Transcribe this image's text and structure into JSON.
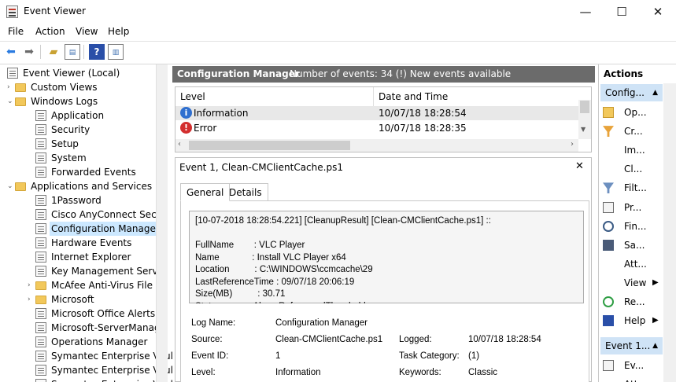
{
  "window": {
    "title": "Event Viewer",
    "minimize": "—",
    "maximize": "☐",
    "close": "✕"
  },
  "menu": [
    "File",
    "Action",
    "View",
    "Help"
  ],
  "tree": {
    "items": [
      {
        "label": "Event Viewer (Local)",
        "depth": 0,
        "icon": "log",
        "twist": ""
      },
      {
        "label": "Custom Views",
        "depth": 1,
        "icon": "folder",
        "twist": "›"
      },
      {
        "label": "Windows Logs",
        "depth": 1,
        "icon": "folder",
        "twist": "⌄"
      },
      {
        "label": "Application",
        "depth": 2,
        "icon": "log",
        "twist": ""
      },
      {
        "label": "Security",
        "depth": 2,
        "icon": "log",
        "twist": ""
      },
      {
        "label": "Setup",
        "depth": 2,
        "icon": "log",
        "twist": ""
      },
      {
        "label": "System",
        "depth": 2,
        "icon": "log",
        "twist": ""
      },
      {
        "label": "Forwarded Events",
        "depth": 2,
        "icon": "log",
        "twist": ""
      },
      {
        "label": "Applications and Services Lo",
        "depth": 1,
        "icon": "folder",
        "twist": "⌄"
      },
      {
        "label": "1Password",
        "depth": 2,
        "icon": "log",
        "twist": ""
      },
      {
        "label": "Cisco AnyConnect Secur",
        "depth": 2,
        "icon": "log",
        "twist": ""
      },
      {
        "label": "Configuration Manager",
        "depth": 2,
        "icon": "log",
        "twist": "",
        "selected": true
      },
      {
        "label": "Hardware Events",
        "depth": 2,
        "icon": "log",
        "twist": ""
      },
      {
        "label": "Internet Explorer",
        "depth": 2,
        "icon": "log",
        "twist": ""
      },
      {
        "label": "Key Management Servic",
        "depth": 2,
        "icon": "log",
        "twist": ""
      },
      {
        "label": "McAfee Anti-Virus File Sy",
        "depth": 2,
        "icon": "folder",
        "twist": "›"
      },
      {
        "label": "Microsoft",
        "depth": 2,
        "icon": "folder",
        "twist": "›"
      },
      {
        "label": "Microsoft Office Alerts",
        "depth": 2,
        "icon": "log",
        "twist": ""
      },
      {
        "label": "Microsoft-ServerManage",
        "depth": 2,
        "icon": "log",
        "twist": ""
      },
      {
        "label": "Operations Manager",
        "depth": 2,
        "icon": "log",
        "twist": ""
      },
      {
        "label": "Symantec Enterprise Vaul",
        "depth": 2,
        "icon": "log",
        "twist": ""
      },
      {
        "label": "Symantec Enterprise Vaul",
        "depth": 2,
        "icon": "log",
        "twist": ""
      },
      {
        "label": "Symantec Enterprise Vaul",
        "depth": 2,
        "icon": "log",
        "twist": ""
      }
    ]
  },
  "center": {
    "title": "Configuration Manager",
    "info": "Number of events: 34 (!) New events available",
    "columns": [
      "Level",
      "Date and Time"
    ],
    "events": [
      {
        "level": "Information",
        "date": "10/07/18 18:28:54",
        "icon": "information-icon",
        "color": "#2f6fcf",
        "glyph": "i"
      },
      {
        "level": "Error",
        "date": "10/07/18 18:28:35",
        "icon": "error-icon",
        "color": "#d32f2f",
        "glyph": "!"
      }
    ]
  },
  "detail": {
    "title": "Event 1, Clean-CMClientCache.ps1",
    "tabs": [
      "General",
      "Details"
    ],
    "message": [
      "[10-07-2018 18:28:54.221] [CleanupResult] [Clean-CMClientCache.ps1] ::",
      "",
      "FullName        : VLC Player",
      "Name             : Install VLC Player x64",
      "Location          : C:\\WINDOWS\\ccmcache\\29",
      "LastReferenceTime : 09/07/18 20:06:19",
      "Size(MB)          : 30.71",
      "Status           : AboveReferencedThreshold"
    ],
    "fields": {
      "log_name_label": "Log Name:",
      "log_name": "Configuration Manager",
      "source_label": "Source:",
      "source": "Clean-CMClientCache.ps1",
      "logged_label": "Logged:",
      "logged": "10/07/18 18:28:54",
      "event_id_label": "Event ID:",
      "event_id": "1",
      "task_label": "Task Category:",
      "task": "(1)",
      "level_label": "Level:",
      "level": "Information",
      "keywords_label": "Keywords:",
      "keywords": "Classic"
    }
  },
  "actions": {
    "title": "Actions",
    "section1": "Config...",
    "items1": [
      {
        "label": "Op...",
        "icon": "open-folder-icon"
      },
      {
        "label": "Cr...",
        "icon": "filter-create-icon"
      },
      {
        "label": "Im...",
        "icon": ""
      },
      {
        "label": "Cl...",
        "icon": ""
      },
      {
        "label": "Filt...",
        "icon": "filter-icon"
      },
      {
        "label": "Pr...",
        "icon": "properties-icon"
      },
      {
        "label": "Fin...",
        "icon": "find-icon"
      },
      {
        "label": "Sa...",
        "icon": "save-icon"
      },
      {
        "label": "Att...",
        "icon": ""
      },
      {
        "label": "View",
        "icon": "",
        "sub": true
      },
      {
        "label": "Re...",
        "icon": "refresh-icon"
      },
      {
        "label": "Help",
        "icon": "help-icon",
        "sub": true
      }
    ],
    "section2": "Event 1...",
    "items2": [
      {
        "label": "Ev...",
        "icon": "event-properties-icon"
      },
      {
        "label": "Att...",
        "icon": ""
      }
    ]
  }
}
